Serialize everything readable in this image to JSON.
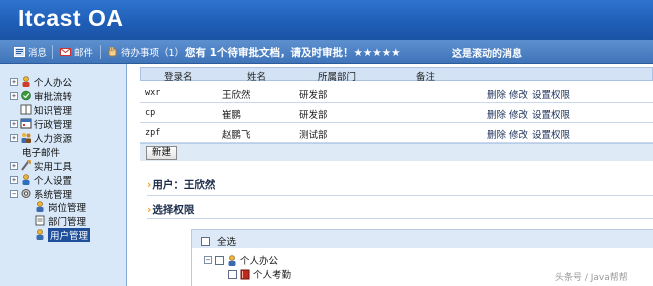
{
  "app": {
    "title": "Itcast OA"
  },
  "toolbar": {
    "message_label": "消息",
    "mail_label": "邮件",
    "todo_label": "待办事项（1）",
    "notice": "您有 1个待审批文档，请及时审批！★★★★★",
    "scroll_message": "这是滚动的消息"
  },
  "sidebar": {
    "items": [
      {
        "label": "个人办公"
      },
      {
        "label": "审批流转"
      },
      {
        "label": "知识管理"
      },
      {
        "label": "行政管理"
      },
      {
        "label": "人力资源"
      },
      {
        "label": "电子邮件"
      },
      {
        "label": "实用工具"
      },
      {
        "label": "个人设置"
      },
      {
        "label": "系统管理"
      },
      {
        "label": "岗位管理"
      },
      {
        "label": "部门管理"
      },
      {
        "label": "用户管理"
      }
    ]
  },
  "table": {
    "headers": [
      "登录名",
      "姓名",
      "所属部门",
      "备注"
    ],
    "rows": [
      {
        "login": "wxr",
        "name": "王欣然",
        "dept": "研发部",
        "note": ""
      },
      {
        "login": "cp",
        "name": "崔鹏",
        "dept": "研发部",
        "note": ""
      },
      {
        "login": "zpf",
        "name": "赵鹏飞",
        "dept": "测试部",
        "note": ""
      }
    ],
    "actions": {
      "delete": "删除",
      "edit": "修改",
      "set_permission": "设置权限"
    }
  },
  "new_button_label": "新建",
  "user_section": {
    "title": "用户：王欣然"
  },
  "permission_section": {
    "title": "选择权限"
  },
  "permission_tree": {
    "select_all": "全选",
    "nodes": [
      {
        "label": "个人办公"
      },
      {
        "label": "个人考勤"
      }
    ]
  },
  "watermark": "头条号 / Java帮帮"
}
